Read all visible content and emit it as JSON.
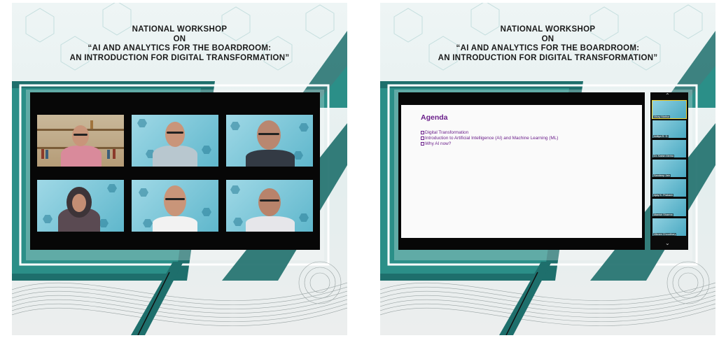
{
  "left_panel": {
    "title_lines": [
      "NATIONAL WORKSHOP",
      "ON",
      "“AI AND ANALYTICS FOR THE BOARDROOM:",
      "AN INTRODUCTION FOR DIGITAL TRANSFORMATION”"
    ],
    "video_tiles": [
      {
        "kind": "office"
      },
      {
        "kind": "participant"
      },
      {
        "kind": "participant"
      },
      {
        "kind": "participant"
      },
      {
        "kind": "participant"
      },
      {
        "kind": "participant"
      }
    ]
  },
  "right_panel": {
    "title_lines": [
      "NATIONAL WORKSHOP",
      "ON",
      "“AI AND ANALYTICS FOR THE BOARDROOM:",
      "AN INTRODUCTION FOR DIGITAL TRANSFORMATION”"
    ],
    "slide": {
      "heading": "Agenda",
      "items": [
        "Digital Transformation",
        "Introduction to Artificial Intelligence (AI) and Machine Learning (ML)",
        "Why AI now?"
      ]
    },
    "participant_thumbnails": [
      {
        "name": "Vinay Mathur",
        "active": true
      },
      {
        "name": "Aditya R. S."
      },
      {
        "name": "Dr. Satish Mehta"
      },
      {
        "name": "Sandeep Jain"
      },
      {
        "name": "Ajay K. Prakash"
      },
      {
        "name": "Manish Sharma"
      },
      {
        "name": "Vikram Choudhary"
      }
    ],
    "scroll_up_icon": "chevron-up-icon",
    "scroll_down_icon": "chevron-down-icon"
  },
  "colors": {
    "teal_dark": "#1e6f6c",
    "teal_mid": "#2b8f88",
    "slide_text": "#6a1e8a",
    "screen_bg": "#070707"
  }
}
